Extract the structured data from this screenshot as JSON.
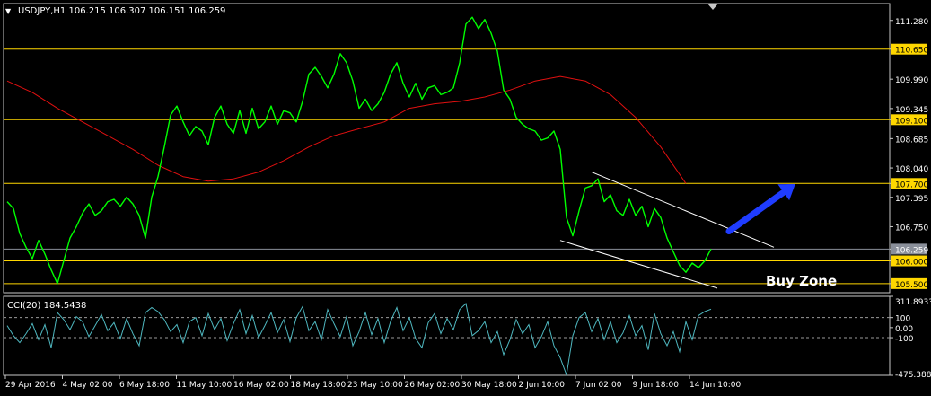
{
  "colors": {
    "background": "#000000",
    "frame": "#c8c8c8",
    "price": "#00ff00",
    "moving_average": "#e01010",
    "support_resistance": "#ffd700",
    "trendline": "#ffffff",
    "cci": "#4fb8c0",
    "current_price_line": "#8a8f9a",
    "arrow": "#1f3cff",
    "text": "#ffffff"
  },
  "header": {
    "menu_icon": "triangle-down-icon",
    "title": "USDJPY,H1  106.215 106.307 106.151 106.259"
  },
  "chart_data": [
    {
      "type": "line",
      "title": "USDJPY,H1",
      "ohlc_readout": {
        "open": 106.215,
        "high": 106.307,
        "low": 106.151,
        "close": 106.259
      },
      "ylim": [
        105.3,
        111.65
      ],
      "y_ticks": [
        "111.280",
        "110.650",
        "109.990",
        "109.345",
        "109.100",
        "108.685",
        "108.040",
        "107.700",
        "107.395",
        "106.750",
        "106.259",
        "106.000",
        "105.500"
      ],
      "x_tick_labels": [
        "29 Apr 2016",
        "4 May 02:00",
        "6 May 18:00",
        "11 May 10:00",
        "16 May 02:00",
        "18 May 18:00",
        "23 May 10:00",
        "26 May 02:00",
        "30 May 18:00",
        "2 Jun 10:00",
        "7 Jun 02:00",
        "9 Jun 18:00",
        "14 Jun 10:00"
      ],
      "series": [
        {
          "style": "price",
          "x": [
            0,
            1,
            2,
            3,
            4,
            5,
            6,
            7,
            8,
            9,
            10,
            11,
            12,
            13,
            14,
            15,
            16,
            17,
            18,
            19,
            20,
            21,
            22,
            23,
            24,
            25,
            26,
            27,
            28,
            29,
            30,
            31,
            32,
            33,
            34,
            35,
            36,
            37,
            38,
            39,
            40,
            41,
            42,
            43,
            44,
            45,
            46,
            47,
            48,
            49,
            50,
            51,
            52,
            53,
            54,
            55,
            56,
            57,
            58,
            59,
            60,
            61,
            62,
            63,
            64,
            65,
            66,
            67,
            68,
            69,
            70,
            71,
            72,
            73,
            74,
            75,
            76,
            77,
            78,
            79,
            80,
            81,
            82,
            83,
            84,
            85,
            86,
            87,
            88,
            89,
            90,
            91,
            92,
            93,
            94,
            95,
            96,
            97,
            98,
            99,
            100,
            101,
            102,
            103,
            104,
            105,
            106,
            107,
            108,
            109,
            110,
            111,
            112
          ],
          "values": [
            107.3,
            107.15,
            106.6,
            106.3,
            106.05,
            106.45,
            106.15,
            105.8,
            105.5,
            106.0,
            106.5,
            106.75,
            107.05,
            107.25,
            107.0,
            107.1,
            107.3,
            107.35,
            107.2,
            107.4,
            107.25,
            107.0,
            106.5,
            107.4,
            107.85,
            108.5,
            109.2,
            109.4,
            109.05,
            108.75,
            108.95,
            108.85,
            108.55,
            109.15,
            109.4,
            109.0,
            108.8,
            109.3,
            108.8,
            109.35,
            108.9,
            109.05,
            109.4,
            109.0,
            109.3,
            109.25,
            109.05,
            109.5,
            110.1,
            110.25,
            110.05,
            109.8,
            110.1,
            110.55,
            110.35,
            109.95,
            109.35,
            109.55,
            109.3,
            109.45,
            109.7,
            110.1,
            110.35,
            109.9,
            109.6,
            109.9,
            109.55,
            109.8,
            109.85,
            109.65,
            109.7,
            109.8,
            110.35,
            111.2,
            111.35,
            111.1,
            111.3,
            111.0,
            110.6,
            109.75,
            109.55,
            109.15,
            109.0,
            108.9,
            108.85,
            108.65,
            108.7,
            108.85,
            108.45,
            106.95,
            106.55,
            107.1,
            107.6,
            107.65,
            107.8,
            107.3,
            107.45,
            107.1,
            107.0,
            107.35,
            107.0,
            107.2,
            106.75,
            107.15,
            106.95,
            106.5,
            106.2,
            105.9,
            105.75,
            105.95,
            105.85,
            106.0,
            106.26
          ]
        },
        {
          "style": "moving_average",
          "x": [
            0,
            4,
            8,
            12,
            16,
            20,
            24,
            28,
            32,
            36,
            40,
            44,
            48,
            52,
            56,
            60,
            64,
            68,
            72,
            76,
            80,
            84,
            88,
            92,
            96,
            100,
            104,
            108
          ],
          "values": [
            109.95,
            109.7,
            109.35,
            109.05,
            108.75,
            108.45,
            108.1,
            107.85,
            107.75,
            107.8,
            107.95,
            108.2,
            108.5,
            108.75,
            108.9,
            109.05,
            109.35,
            109.45,
            109.5,
            109.6,
            109.75,
            109.95,
            110.05,
            109.95,
            109.65,
            109.15,
            108.5,
            107.7
          ]
        },
        {
          "style": "trendline",
          "x": [
            93,
            122
          ],
          "values": [
            107.95,
            106.3
          ]
        },
        {
          "style": "trendline",
          "x": [
            88,
            113
          ],
          "values": [
            106.45,
            105.4
          ]
        }
      ],
      "horizontal_levels": [
        110.65,
        109.1,
        107.7,
        106.0,
        105.5
      ],
      "current_price": 106.259,
      "annotations": {
        "zone_label": "Buy Zone"
      }
    },
    {
      "type": "line",
      "title": "CCI(20) 184.5438",
      "ylim": [
        -475.388,
        311.8933
      ],
      "y_ticks": [
        "311.8933",
        "100",
        "0.00",
        "-100",
        "-475.388"
      ],
      "series": [
        {
          "style": "cci",
          "x": [
            0,
            1,
            2,
            3,
            4,
            5,
            6,
            7,
            8,
            9,
            10,
            11,
            12,
            13,
            14,
            15,
            16,
            17,
            18,
            19,
            20,
            21,
            22,
            23,
            24,
            25,
            26,
            27,
            28,
            29,
            30,
            31,
            32,
            33,
            34,
            35,
            36,
            37,
            38,
            39,
            40,
            41,
            42,
            43,
            44,
            45,
            46,
            47,
            48,
            49,
            50,
            51,
            52,
            53,
            54,
            55,
            56,
            57,
            58,
            59,
            60,
            61,
            62,
            63,
            64,
            65,
            66,
            67,
            68,
            69,
            70,
            71,
            72,
            73,
            74,
            75,
            76,
            77,
            78,
            79,
            80,
            81,
            82,
            83,
            84,
            85,
            86,
            87,
            88,
            89,
            90,
            91,
            92,
            93,
            94,
            95,
            96,
            97,
            98,
            99,
            100,
            101,
            102,
            103,
            104,
            105,
            106,
            107,
            108,
            109,
            110,
            111,
            112
          ],
          "values": [
            20,
            -80,
            -150,
            -60,
            40,
            -120,
            30,
            -200,
            150,
            80,
            -20,
            110,
            60,
            -90,
            20,
            130,
            -30,
            50,
            -110,
            90,
            -60,
            -180,
            150,
            200,
            160,
            80,
            -40,
            30,
            -150,
            60,
            100,
            -80,
            140,
            -20,
            90,
            -130,
            40,
            180,
            -60,
            120,
            -100,
            20,
            150,
            -50,
            80,
            -140,
            100,
            210,
            -30,
            60,
            -120,
            180,
            40,
            -90,
            110,
            -180,
            -40,
            150,
            -70,
            90,
            -150,
            60,
            200,
            -30,
            100,
            -110,
            -200,
            50,
            140,
            -60,
            90,
            -20,
            180,
            240,
            -80,
            -30,
            60,
            -150,
            -40,
            -270,
            -120,
            80,
            -60,
            30,
            -200,
            -90,
            60,
            -180,
            -300,
            -470,
            -80,
            100,
            150,
            -40,
            90,
            -120,
            60,
            -150,
            -50,
            120,
            -80,
            20,
            -220,
            140,
            -60,
            -180,
            -40,
            -240,
            60,
            -120,
            120,
            160,
            184
          ]
        }
      ]
    }
  ]
}
